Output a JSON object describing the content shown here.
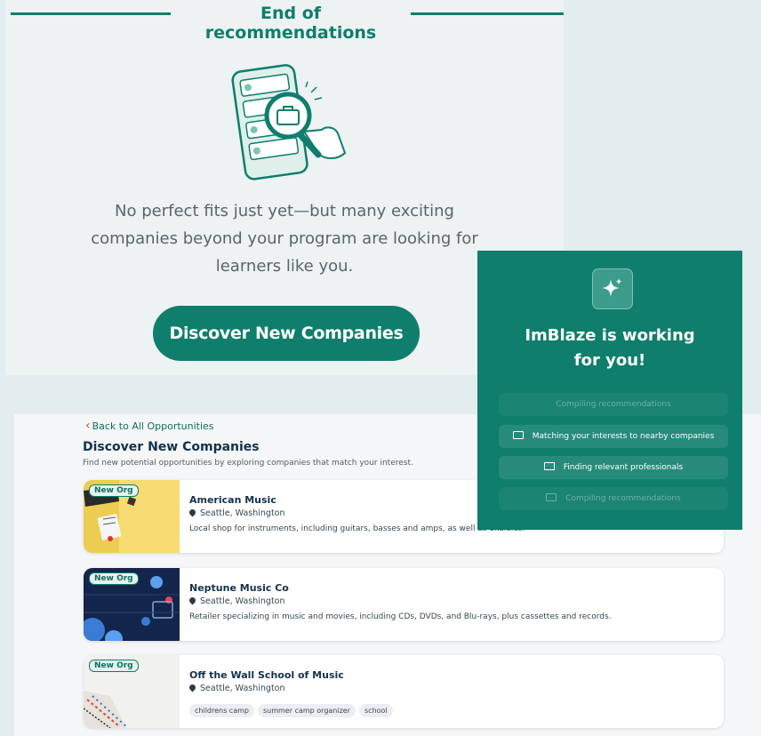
{
  "end_section": {
    "title": "End of recommendations",
    "message_lines": [
      "No perfect fits just yet—but many exciting",
      "companies beyond your program are looking for",
      "learners like you."
    ],
    "cta_label": "Discover New Companies"
  },
  "discover_page": {
    "back_label": "Back to All Opportunities",
    "title": "Discover New Companies",
    "subtitle": "Find new potential opportunities by exploring companies that match your interest.",
    "badge_label": "New Org",
    "companies": [
      {
        "name": "American Music",
        "location": "Seattle, Washington",
        "description": "Local shop for instruments, including guitars, basses and amps, as well as ukuleles."
      },
      {
        "name": "Neptune Music Co",
        "location": "Seattle, Washington",
        "description": "Retailer specializing in music and movies, including CDs, DVDs, and Blu-rays, plus cassettes and records."
      },
      {
        "name": "Off the Wall School of Music",
        "location": "Seattle, Washington",
        "tags": [
          "childrens camp",
          "summer camp organizer",
          "school"
        ]
      }
    ]
  },
  "overlay": {
    "title_line1": "ImBlaze is working",
    "title_line2": "for you!",
    "steps": [
      "Compiling recommendations",
      "Matching your interests to nearby companies",
      "Finding relevant professionals",
      "Compiling recommendations"
    ]
  },
  "colors": {
    "brand_teal": "#0f7e6c",
    "heading_navy": "#15324a",
    "back_chevron": "#d04a3a"
  }
}
